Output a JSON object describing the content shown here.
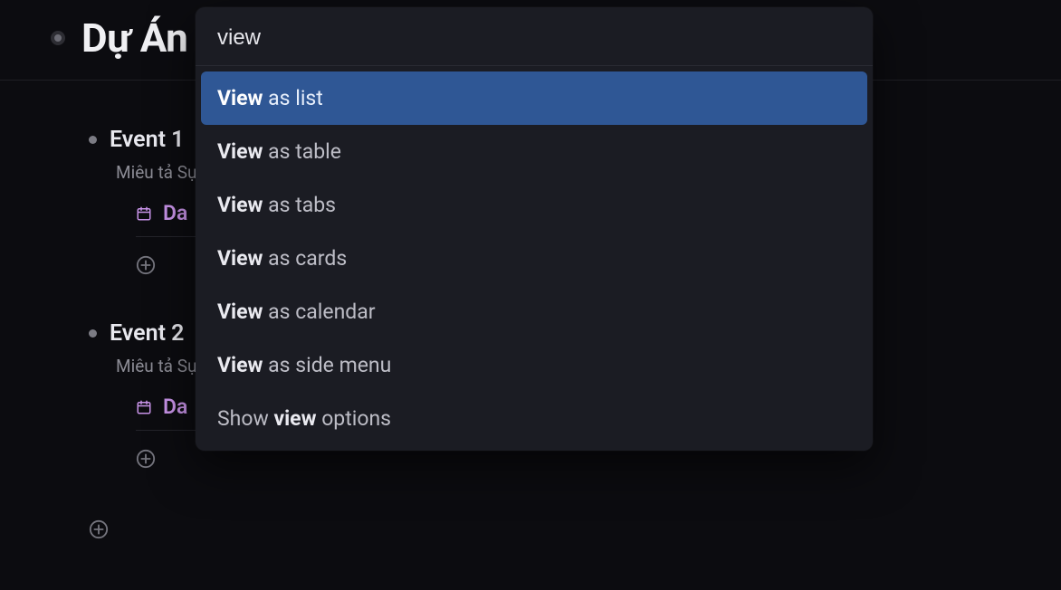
{
  "page": {
    "title": "Dự Án"
  },
  "events": [
    {
      "title": "Event 1",
      "description": "Miêu tả Sự",
      "date_field_label": "Da"
    },
    {
      "title": "Event 2",
      "description": "Miêu tả Sự",
      "date_field_label": "Da"
    }
  ],
  "popover": {
    "query": "view",
    "items": [
      {
        "bold": "View",
        "rest": " as list",
        "selected": true
      },
      {
        "bold": "View",
        "rest": " as table",
        "selected": false
      },
      {
        "bold": "View",
        "rest": " as tabs",
        "selected": false
      },
      {
        "bold": "View",
        "rest": " as cards",
        "selected": false
      },
      {
        "bold": "View",
        "rest": " as calendar",
        "selected": false
      },
      {
        "bold": "View",
        "rest": " as side menu",
        "selected": false
      },
      {
        "prefix": "Show ",
        "bold": "view",
        "rest": " options",
        "selected": false
      }
    ]
  }
}
